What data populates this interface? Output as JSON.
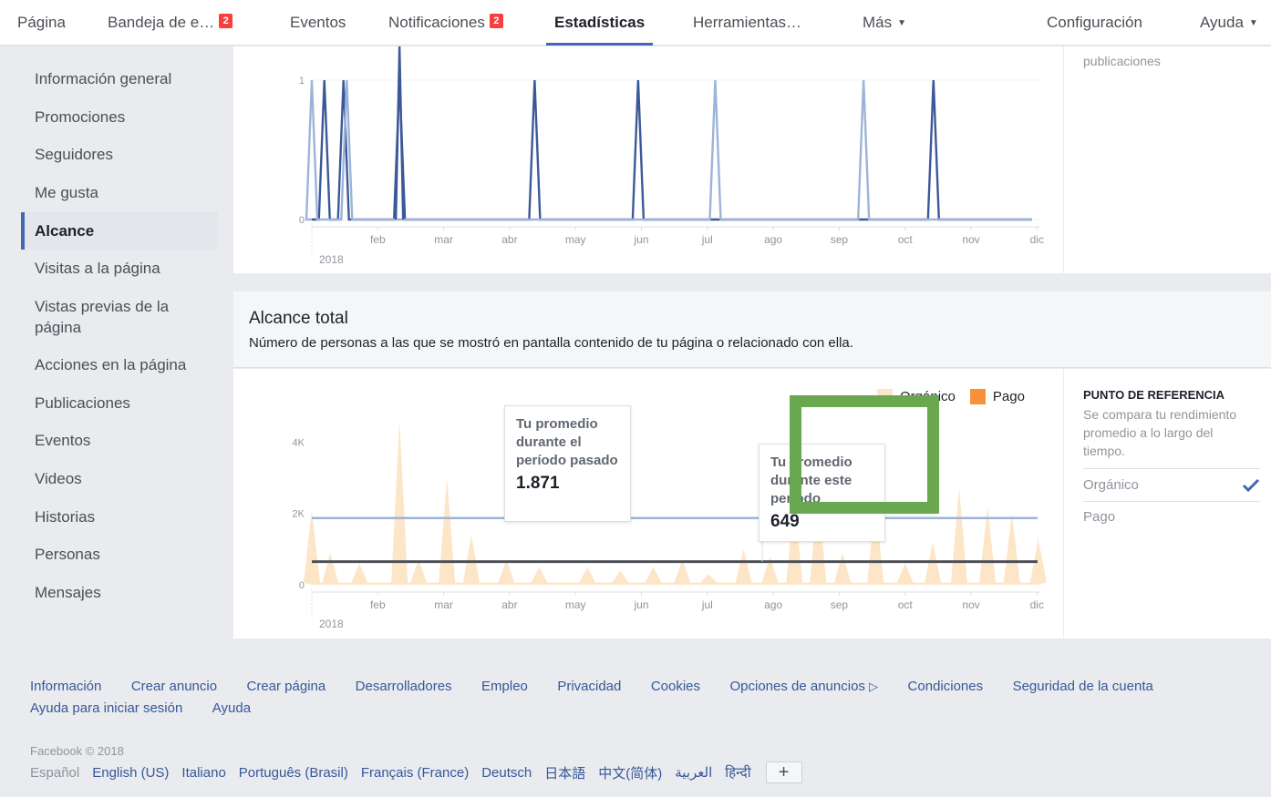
{
  "nav": {
    "items": [
      {
        "label": "Página"
      },
      {
        "label": "Bandeja de e…",
        "badge": "2"
      },
      {
        "label": "Eventos"
      },
      {
        "label": "Notificaciones",
        "badge": "2"
      },
      {
        "label": "Estadísticas",
        "active": true
      },
      {
        "label": "Herramientas…"
      },
      {
        "label": "Más"
      },
      {
        "label": "Configuración"
      },
      {
        "label": "Ayuda"
      }
    ]
  },
  "sidebar": {
    "items": [
      {
        "label": "Información general"
      },
      {
        "label": "Promociones"
      },
      {
        "label": "Seguidores"
      },
      {
        "label": "Me gusta"
      },
      {
        "label": "Alcance",
        "active": true
      },
      {
        "label": "Visitas a la página"
      },
      {
        "label": "Vistas previas de la página"
      },
      {
        "label": "Acciones en la página"
      },
      {
        "label": "Publicaciones"
      },
      {
        "label": "Eventos"
      },
      {
        "label": "Videos"
      },
      {
        "label": "Historias"
      },
      {
        "label": "Personas"
      },
      {
        "label": "Mensajes"
      }
    ]
  },
  "top_card": {
    "side_text": "publicaciones"
  },
  "total_reach": {
    "title": "Alcance total",
    "subtitle": "Número de personas a las que se mostró en pantalla contenido de tu página o relacionado con ella.",
    "legend": {
      "organic": "Orgánico",
      "paid": "Pago"
    },
    "callout_past": {
      "title": "Tu promedio durante el período pasado",
      "value": "1.871"
    },
    "callout_current": {
      "title": "Tu promedio durante este período",
      "value": "649"
    },
    "benchmark": {
      "heading": "PUNTO DE REFERENCIA",
      "description": "Se compara tu rendimiento promedio a lo largo del tiempo.",
      "options": [
        {
          "label": "Orgánico",
          "checked": true
        },
        {
          "label": "Pago",
          "checked": false
        }
      ]
    }
  },
  "colors": {
    "accent": "#4267b2",
    "organic_fill": "#fde6c8",
    "paid": "#f7923a",
    "line_dark": "#3b5998",
    "line_light": "#9cb4d8",
    "avg_dark": "#4b4f56",
    "annotation_box": "#6aa84f"
  },
  "chart_data": [
    {
      "type": "line",
      "x_ticks": [
        "feb",
        "mar",
        "abr",
        "may",
        "jun",
        "jul",
        "ago",
        "sep",
        "oct",
        "nov",
        "dic"
      ],
      "year_label": "2018",
      "y_ticks": [
        "0",
        "1"
      ],
      "ylim": [
        0,
        1
      ],
      "series": [
        {
          "color": "dark",
          "spikes": [
            0.19,
            0.48,
            1.33,
            3.38,
            4.95,
            9.43
          ]
        },
        {
          "color": "light",
          "spikes": [
            0.0,
            0.53,
            6.12,
            8.37
          ]
        }
      ]
    },
    {
      "type": "area",
      "x_ticks": [
        "feb",
        "mar",
        "abr",
        "may",
        "jun",
        "jul",
        "ago",
        "sep",
        "oct",
        "nov",
        "dic"
      ],
      "year_label": "2018",
      "y_ticks": [
        "0",
        "2K",
        "4K"
      ],
      "ylim": [
        0,
        4800
      ],
      "organic_peaks": [
        {
          "x": 0.0,
          "y": 2100
        },
        {
          "x": 0.28,
          "y": 900
        },
        {
          "x": 0.72,
          "y": 600
        },
        {
          "x": 1.33,
          "y": 4600
        },
        {
          "x": 1.62,
          "y": 700
        },
        {
          "x": 2.05,
          "y": 3000
        },
        {
          "x": 2.42,
          "y": 1400
        },
        {
          "x": 2.95,
          "y": 700
        },
        {
          "x": 3.45,
          "y": 500
        },
        {
          "x": 4.18,
          "y": 500
        },
        {
          "x": 4.68,
          "y": 400
        },
        {
          "x": 5.18,
          "y": 500
        },
        {
          "x": 5.62,
          "y": 700
        },
        {
          "x": 6.02,
          "y": 300
        },
        {
          "x": 6.55,
          "y": 1000
        },
        {
          "x": 6.95,
          "y": 800
        },
        {
          "x": 7.32,
          "y": 2400
        },
        {
          "x": 7.68,
          "y": 2600
        },
        {
          "x": 8.05,
          "y": 900
        },
        {
          "x": 8.55,
          "y": 2300
        },
        {
          "x": 9.0,
          "y": 600
        },
        {
          "x": 9.42,
          "y": 1200
        },
        {
          "x": 9.82,
          "y": 2700
        },
        {
          "x": 10.25,
          "y": 2200
        },
        {
          "x": 10.62,
          "y": 2000
        },
        {
          "x": 11.02,
          "y": 1300
        }
      ],
      "avg_past": 1871,
      "avg_current": 649
    }
  ],
  "footer": {
    "links": [
      "Información",
      "Crear anuncio",
      "Crear página",
      "Desarrolladores",
      "Empleo",
      "Privacidad",
      "Cookies",
      "Opciones de anuncios",
      "Condiciones",
      "Seguridad de la cuenta",
      "Ayuda para iniciar sesión",
      "Ayuda"
    ],
    "copyright": "Facebook © 2018",
    "languages": [
      "Español",
      "English (US)",
      "Italiano",
      "Português (Brasil)",
      "Français (France)",
      "Deutsch",
      "日本語",
      "中文(简体)",
      "العربية",
      "हिन्दी"
    ],
    "more_languages": "+"
  }
}
